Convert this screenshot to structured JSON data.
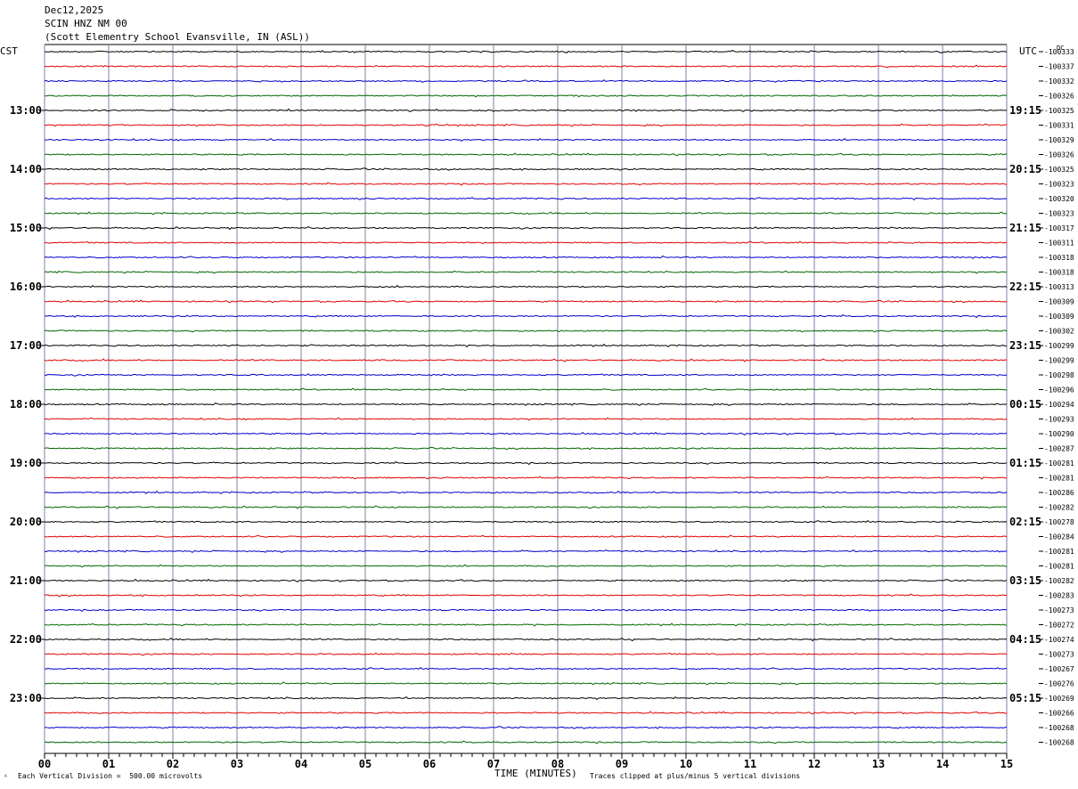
{
  "header": {
    "date": "Dec12,2025",
    "station": "SCIN HNZ NM 00",
    "location": "(Scott Elementry School Evansville, IN (ASL))"
  },
  "left_axis_label": "CST",
  "right_axis_label": "UTC",
  "dc_label": "DC",
  "footer": {
    "scale_note": "Each Vertical Division =  500.00 microvolts",
    "x_axis_label": "TIME (MINUTES)",
    "clip_note": "Traces clipped at plus/minus 5 vertical divisions",
    "corner_mark": "ᴬ"
  },
  "chart_data": {
    "type": "line",
    "description_type": "helicorder",
    "x_ticks": [
      "00",
      "01",
      "02",
      "03",
      "04",
      "05",
      "06",
      "07",
      "08",
      "09",
      "10",
      "11",
      "12",
      "13",
      "14",
      "15"
    ],
    "x_range": [
      0,
      15
    ],
    "left_hour_labels": [
      "13:00",
      "14:00",
      "15:00",
      "16:00",
      "17:00",
      "18:00",
      "19:00",
      "20:00",
      "21:00",
      "22:00",
      "23:00"
    ],
    "right_hour_labels": [
      "19:15",
      "20:15",
      "21:15",
      "22:15",
      "23:15",
      "00:15",
      "01:15",
      "02:15",
      "03:15",
      "04:15",
      "05:15"
    ],
    "trace_colors": [
      "#000000",
      "#e00000",
      "#0000cc",
      "#006600"
    ],
    "dc_values": [
      "-100333",
      "-100337",
      "-100332",
      "-100326",
      "-100325",
      "-100331",
      "-100329",
      "-100326",
      "-100325",
      "-100323",
      "-100320",
      "-100323",
      "-100317",
      "-100311",
      "-100318",
      "-100318",
      "-100313",
      "-100309",
      "-100309",
      "-100302",
      "-100299",
      "-100299",
      "-100298",
      "-100296",
      "-100294",
      "-100293",
      "-100290",
      "-100287",
      "-100281",
      "-100281",
      "-100286",
      "-100282",
      "-100278",
      "-100284",
      "-100281",
      "-100281",
      "-100282",
      "-100283",
      "-100273",
      "-100272",
      "-100274",
      "-100273",
      "-100267",
      "-100276",
      "-100269",
      "-100266",
      "-100268",
      "-100268"
    ],
    "grid": true
  }
}
